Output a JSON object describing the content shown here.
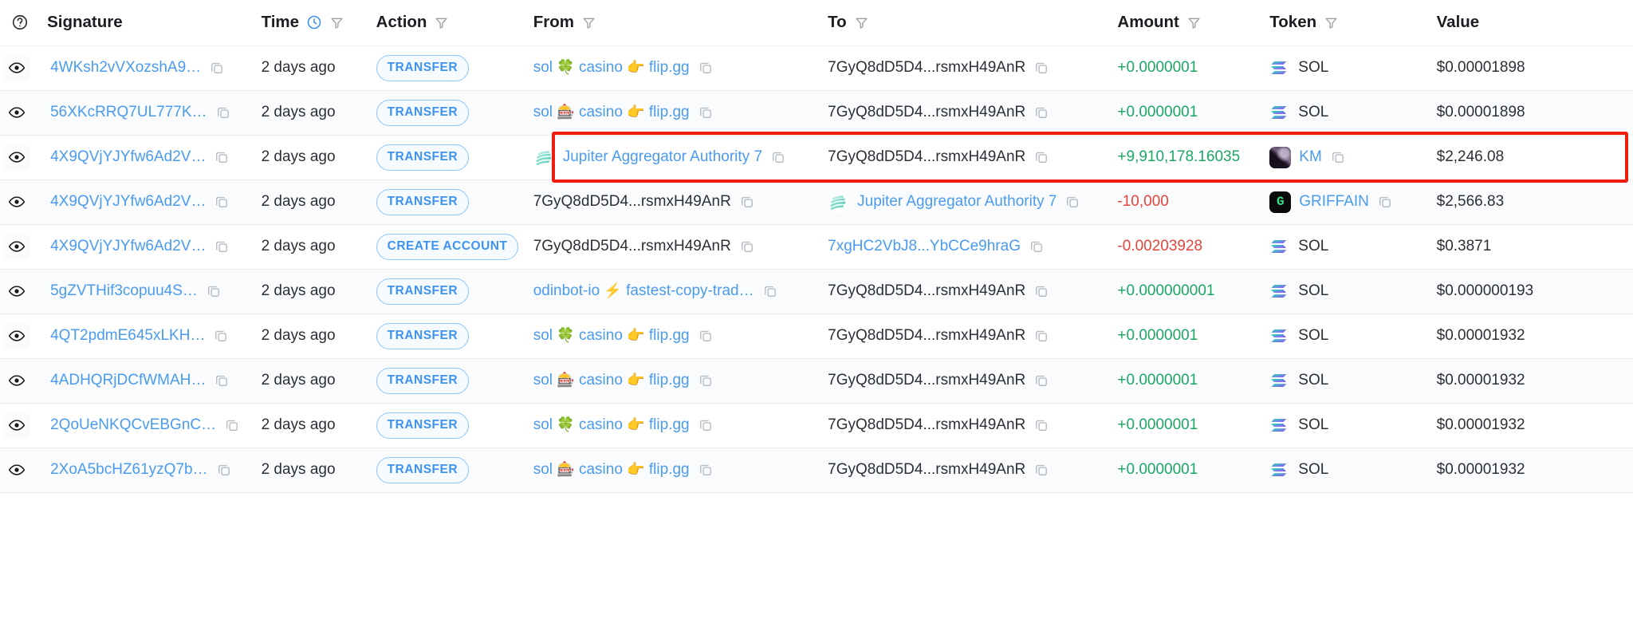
{
  "table": {
    "columns": [
      {
        "key": "eye",
        "label": "",
        "icon": "help-circle-icon",
        "filter": false
      },
      {
        "key": "signature",
        "label": "Signature",
        "filter": false
      },
      {
        "key": "time",
        "label": "Time",
        "icon": "clock-icon",
        "filter": true
      },
      {
        "key": "action",
        "label": "Action",
        "filter": true
      },
      {
        "key": "from",
        "label": "From",
        "filter": true
      },
      {
        "key": "to",
        "label": "To",
        "filter": true
      },
      {
        "key": "amount",
        "label": "Amount",
        "filter": true
      },
      {
        "key": "token",
        "label": "Token",
        "filter": true
      },
      {
        "key": "value",
        "label": "Value",
        "filter": false
      }
    ],
    "rows": [
      {
        "signature": "4WKsh2vVXozshA9…",
        "time": "2 days ago",
        "action": "TRANSFER",
        "from": {
          "prefix": "sol",
          "emoji1": "🍀",
          "mid": "casino",
          "emoji2": "👉",
          "suffix": "flip.gg",
          "type": "label"
        },
        "to": {
          "text": "7GyQ8dD5D4...rsmxH49AnR",
          "type": "address-plain"
        },
        "amount": "+0.0000001",
        "amount_sign": "positive",
        "token": {
          "name": "SOL",
          "icon": "sol-icon",
          "link": false,
          "copy": false
        },
        "value": "$0.00001898",
        "highlighted": false
      },
      {
        "signature": "56XKcRRQ7UL777K…",
        "time": "2 days ago",
        "action": "TRANSFER",
        "from": {
          "prefix": "sol",
          "emoji1": "🎰",
          "mid": "casino",
          "emoji2": "👉",
          "suffix": "flip.gg",
          "type": "label"
        },
        "to": {
          "text": "7GyQ8dD5D4...rsmxH49AnR",
          "type": "address-plain"
        },
        "amount": "+0.0000001",
        "amount_sign": "positive",
        "token": {
          "name": "SOL",
          "icon": "sol-icon",
          "link": false,
          "copy": false
        },
        "value": "$0.00001898",
        "highlighted": false
      },
      {
        "signature": "4X9QVjYJYfw6Ad2V…",
        "time": "2 days ago",
        "action": "TRANSFER",
        "from": {
          "text": "Jupiter Aggregator Authority 7",
          "icon": "jupiter-icon",
          "type": "named-program"
        },
        "to": {
          "text": "7GyQ8dD5D4...rsmxH49AnR",
          "type": "address-plain"
        },
        "amount": "+9,910,178.16035",
        "amount_sign": "positive",
        "token": {
          "name": "KM",
          "icon": "km-token-icon",
          "link": true,
          "copy": true
        },
        "value": "$2,246.08",
        "highlighted": true
      },
      {
        "signature": "4X9QVjYJYfw6Ad2V…",
        "time": "2 days ago",
        "action": "TRANSFER",
        "from": {
          "text": "7GyQ8dD5D4...rsmxH49AnR",
          "type": "address-plain"
        },
        "to": {
          "text": "Jupiter Aggregator Authority 7",
          "icon": "jupiter-icon",
          "type": "named-program"
        },
        "amount": "-10,000",
        "amount_sign": "negative",
        "token": {
          "name": "GRIFFAIN",
          "icon": "griffain-token-icon",
          "link": true,
          "copy": true
        },
        "value": "$2,566.83",
        "highlighted": false
      },
      {
        "signature": "4X9QVjYJYfw6Ad2V…",
        "time": "2 days ago",
        "action": "CREATE ACCOUNT",
        "from": {
          "text": "7GyQ8dD5D4...rsmxH49AnR",
          "type": "address-plain"
        },
        "to": {
          "text": "7xgHC2VbJ8...YbCCe9hraG",
          "type": "address-link"
        },
        "amount": "-0.00203928",
        "amount_sign": "negative",
        "token": {
          "name": "SOL",
          "icon": "sol-icon",
          "link": false,
          "copy": false
        },
        "value": "$0.3871",
        "highlighted": false
      },
      {
        "signature": "5gZVTHif3copuu4S…",
        "time": "2 days ago",
        "action": "TRANSFER",
        "from": {
          "prefix": "odinbot-io",
          "emoji1": "⚡",
          "mid": "fastest-copy-trad…",
          "type": "label2"
        },
        "to": {
          "text": "7GyQ8dD5D4...rsmxH49AnR",
          "type": "address-plain"
        },
        "amount": "+0.000000001",
        "amount_sign": "positive",
        "token": {
          "name": "SOL",
          "icon": "sol-icon",
          "link": false,
          "copy": false
        },
        "value": "$0.000000193",
        "highlighted": false
      },
      {
        "signature": "4QT2pdmE645xLKH…",
        "time": "2 days ago",
        "action": "TRANSFER",
        "from": {
          "prefix": "sol",
          "emoji1": "🍀",
          "mid": "casino",
          "emoji2": "👉",
          "suffix": "flip.gg",
          "type": "label"
        },
        "to": {
          "text": "7GyQ8dD5D4...rsmxH49AnR",
          "type": "address-plain"
        },
        "amount": "+0.0000001",
        "amount_sign": "positive",
        "token": {
          "name": "SOL",
          "icon": "sol-icon",
          "link": false,
          "copy": false
        },
        "value": "$0.00001932",
        "highlighted": false
      },
      {
        "signature": "4ADHQRjDCfWMAH…",
        "time": "2 days ago",
        "action": "TRANSFER",
        "from": {
          "prefix": "sol",
          "emoji1": "🎰",
          "mid": "casino",
          "emoji2": "👉",
          "suffix": "flip.gg",
          "type": "label"
        },
        "to": {
          "text": "7GyQ8dD5D4...rsmxH49AnR",
          "type": "address-plain"
        },
        "amount": "+0.0000001",
        "amount_sign": "positive",
        "token": {
          "name": "SOL",
          "icon": "sol-icon",
          "link": false,
          "copy": false
        },
        "value": "$0.00001932",
        "highlighted": false
      },
      {
        "signature": "2QoUeNKQCvEBGnC…",
        "time": "2 days ago",
        "action": "TRANSFER",
        "from": {
          "prefix": "sol",
          "emoji1": "🍀",
          "mid": "casino",
          "emoji2": "👉",
          "suffix": "flip.gg",
          "type": "label"
        },
        "to": {
          "text": "7GyQ8dD5D4...rsmxH49AnR",
          "type": "address-plain"
        },
        "amount": "+0.0000001",
        "amount_sign": "positive",
        "token": {
          "name": "SOL",
          "icon": "sol-icon",
          "link": false,
          "copy": false
        },
        "value": "$0.00001932",
        "highlighted": false
      },
      {
        "signature": "2XoA5bcHZ61yzQ7b…",
        "time": "2 days ago",
        "action": "TRANSFER",
        "from": {
          "prefix": "sol",
          "emoji1": "🎰",
          "mid": "casino",
          "emoji2": "👉",
          "suffix": "flip.gg",
          "type": "label"
        },
        "to": {
          "text": "7GyQ8dD5D4...rsmxH49AnR",
          "type": "address-plain"
        },
        "amount": "+0.0000001",
        "amount_sign": "positive",
        "token": {
          "name": "SOL",
          "icon": "sol-icon",
          "link": false,
          "copy": false
        },
        "value": "$0.00001932",
        "highlighted": false
      }
    ]
  },
  "annotation": {
    "highlight_color": "#f01d0f",
    "highlighted_row_index": 2
  },
  "colors": {
    "link": "#4a9bf0",
    "positive": "#1da665",
    "negative": "#e2453c",
    "pill_border": "#8fc5f5",
    "pill_text": "#3d93ef",
    "row_alt": "#fafbfc",
    "border": "#eceef1"
  }
}
